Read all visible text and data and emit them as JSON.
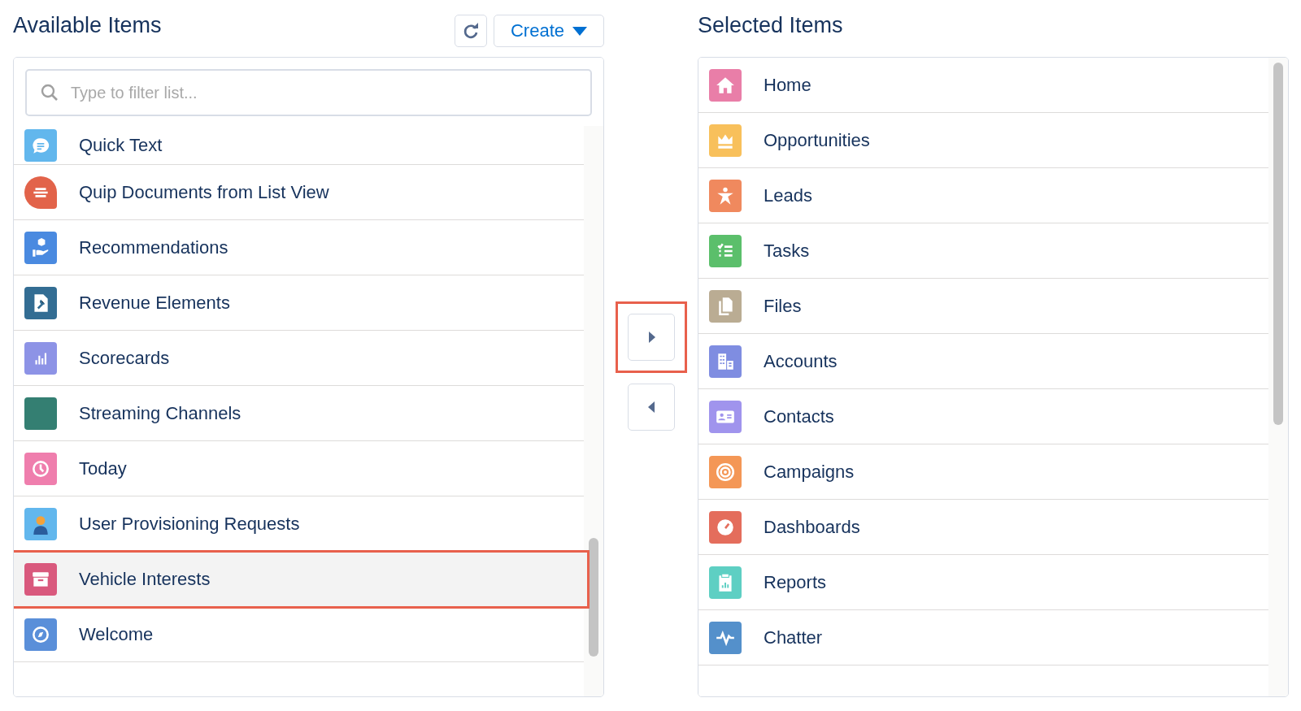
{
  "available": {
    "title": "Available Items",
    "create_button": {
      "label": "Create"
    },
    "search": {
      "placeholder": "Type to filter list..."
    },
    "items": [
      {
        "label": "Quick Text",
        "color": "#62b7ed",
        "selected": false
      },
      {
        "label": "Quip Documents from List View",
        "color": "#e2634a",
        "selected": false
      },
      {
        "label": "Recommendations",
        "color": "#4a8ae0",
        "selected": false
      },
      {
        "label": "Revenue Elements",
        "color": "#336d93",
        "selected": false
      },
      {
        "label": "Scorecards",
        "color": "#8d93e6",
        "selected": false
      },
      {
        "label": "Streaming Channels",
        "color": "#347f72",
        "selected": false
      },
      {
        "label": "Today",
        "color": "#ef7ead",
        "selected": false
      },
      {
        "label": "User Provisioning Requests",
        "color": "#62b7ed",
        "selected": false
      },
      {
        "label": "Vehicle Interests",
        "color": "#d9597d",
        "selected": true
      },
      {
        "label": "Welcome",
        "color": "#5a8fd9",
        "selected": false
      }
    ]
  },
  "move_buttons": [
    {
      "kind": "right",
      "highlighted": true
    },
    {
      "kind": "left",
      "highlighted": false
    }
  ],
  "selected": {
    "title": "Selected Items",
    "items": [
      {
        "label": "Home",
        "color": "#e97ea8",
        "selected": false
      },
      {
        "label": "Opportunities",
        "color": "#f8c05b",
        "selected": false
      },
      {
        "label": "Leads",
        "color": "#f0895e",
        "selected": false
      },
      {
        "label": "Tasks",
        "color": "#5bbf6b",
        "selected": false
      },
      {
        "label": "Files",
        "color": "#baac93",
        "selected": false
      },
      {
        "label": "Accounts",
        "color": "#7f8de1",
        "selected": false
      },
      {
        "label": "Contacts",
        "color": "#a094ed",
        "selected": false
      },
      {
        "label": "Campaigns",
        "color": "#f49756",
        "selected": false
      },
      {
        "label": "Dashboards",
        "color": "#e46d5c",
        "selected": false
      },
      {
        "label": "Reports",
        "color": "#5ecfc3",
        "selected": false
      },
      {
        "label": "Chatter",
        "color": "#5490cb",
        "selected": false
      }
    ]
  }
}
